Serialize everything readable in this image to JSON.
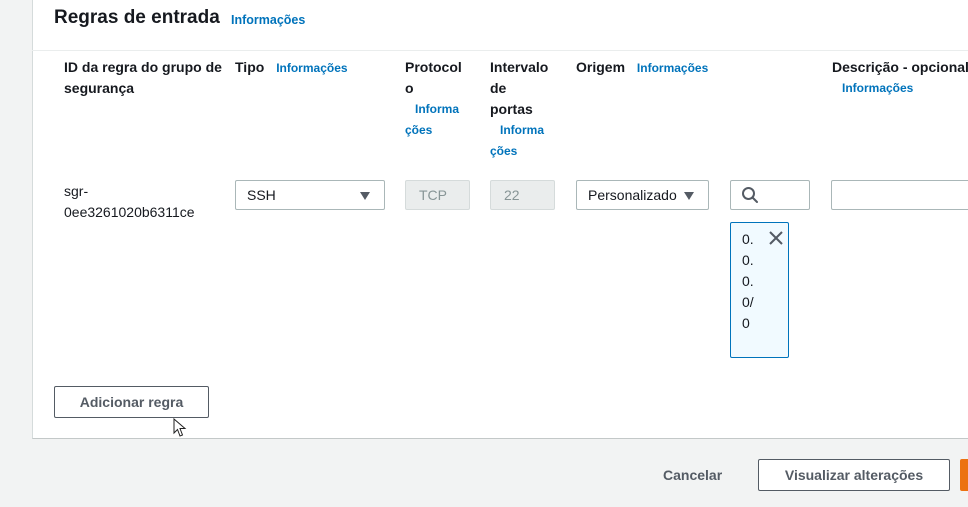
{
  "section": {
    "title": "Regras de entrada",
    "info_label": "Informações"
  },
  "columns": {
    "rule_id": {
      "label": "ID da regra do grupo de segurança"
    },
    "type": {
      "label": "Tipo",
      "info": "Informações"
    },
    "protocol": {
      "label_part1": "Protocol",
      "label_part2": "o",
      "info_part1": "Informa",
      "info_part2": "ções"
    },
    "port_range": {
      "label_part1": "Intervalo",
      "label_part2": "de",
      "label_part3": "portas",
      "info_part1": "Informa",
      "info_part2": "ções"
    },
    "source": {
      "label": "Origem",
      "info": "Informações"
    },
    "description": {
      "label": "Descrição - opcional",
      "info": "Informações"
    }
  },
  "rule": {
    "id_line1": "sgr-",
    "id_line2": "0ee3261020b6311ce",
    "type_value": "SSH",
    "protocol_value": "TCP",
    "port_value": "22",
    "source_value": "Personalizado",
    "search_placeholder": "",
    "cidr_token": "0.0.0.0/0",
    "description_value": ""
  },
  "buttons": {
    "add_rule": "Adicionar regra",
    "cancel": "Cancelar",
    "preview": "Visualizar alterações"
  },
  "icons": {
    "type_caret": "caret-down-icon",
    "source_caret": "caret-down-icon",
    "search": "search-icon",
    "close": "close-icon",
    "cursor": "mouse-pointer-icon"
  },
  "colors": {
    "link": "#0073bb",
    "primary": "#ec7211",
    "token_border": "#0073bb",
    "token_bg": "#f1faff"
  }
}
